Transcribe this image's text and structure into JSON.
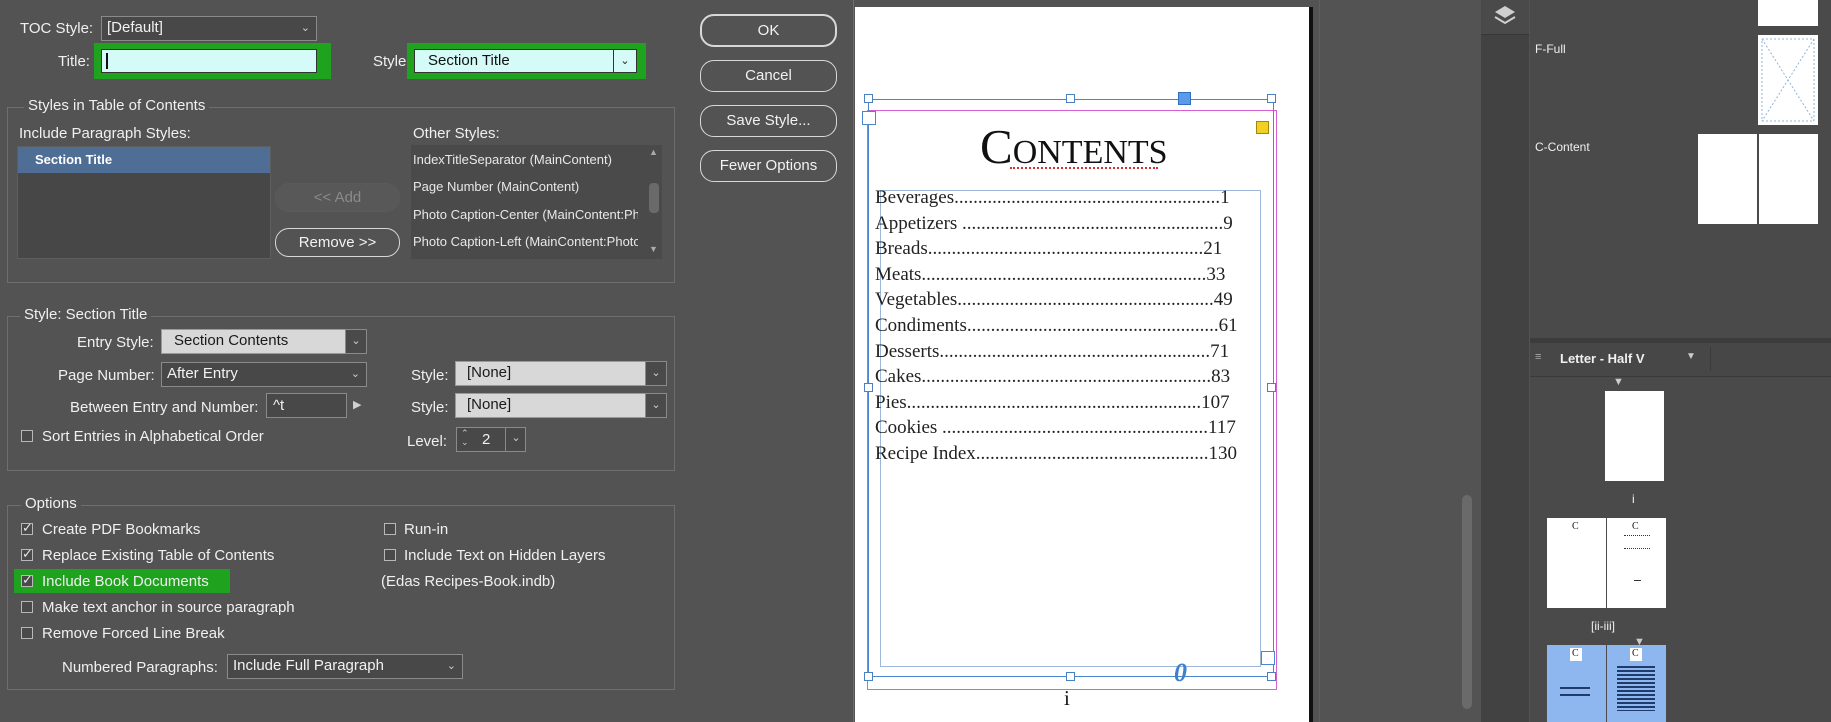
{
  "dialog": {
    "toc_style_label": "TOC Style:",
    "toc_style_value": "[Default]",
    "title_label": "Title:",
    "title_value": "",
    "style_label": "Style:",
    "style_value": "Section Title",
    "buttons": {
      "ok": "OK",
      "cancel": "Cancel",
      "save_style": "Save Style...",
      "fewer_options": "Fewer Options"
    },
    "styles_group": {
      "title": "Styles in Table of Contents",
      "include_label": "Include Paragraph Styles:",
      "include_items": [
        "Section Title"
      ],
      "add_button": "<< Add",
      "remove_button": "Remove >>",
      "other_label": "Other Styles:",
      "other_items": [
        "IndexTitleSeparator (MainContent)",
        "Page Number (MainContent)",
        "Photo Caption-Center (MainContent:Ph...",
        "Photo Caption-Left (MainContent:Photo..."
      ]
    },
    "style_group": {
      "title": "Style: Section Title",
      "entry_style_label": "Entry Style:",
      "entry_style_value": "Section Contents",
      "page_number_label": "Page Number:",
      "page_number_value": "After Entry",
      "page_number_style_label": "Style:",
      "page_number_style_value": "[None]",
      "between_label": "Between Entry and Number:",
      "between_value": "^t",
      "between_style_label": "Style:",
      "between_style_value": "[None]",
      "sort_label": "Sort Entries in Alphabetical Order",
      "level_label": "Level:",
      "level_value": "2"
    },
    "options_group": {
      "title": "Options",
      "create_pdf": "Create PDF Bookmarks",
      "replace_existing": "Replace Existing Table of Contents",
      "include_book": "Include Book Documents",
      "make_anchor": "Make text anchor in source paragraph",
      "remove_break": "Remove Forced Line Break",
      "run_in": "Run-in",
      "hidden_layers": "Include Text on Hidden Layers",
      "book_file": "(Edas Recipes-Book.indb)",
      "numbered_label": "Numbered Paragraphs:",
      "numbered_value": "Include Full Paragraph"
    },
    "checkbox_states": {
      "create_pdf": true,
      "replace_existing": true,
      "include_book": true,
      "make_anchor": false,
      "remove_break": false,
      "run_in": false,
      "hidden_layers": false,
      "sort": false
    }
  },
  "document": {
    "heading_first": "C",
    "heading_rest": "ONTENTS",
    "entries": [
      "Beverages........................................................1",
      "Appetizers .......................................................9",
      "Breads..........................................................21",
      "Meats............................................................33",
      "Vegetables......................................................49",
      "Condiments.....................................................61",
      "Desserts.........................................................71",
      "Cakes.............................................................83",
      "Pies..............................................................107",
      "Cookies ........................................................117",
      "Recipe Index.................................................130"
    ],
    "overset_marker": "0",
    "page_folio": "i"
  },
  "pages_panel": {
    "master_f": "F-Full",
    "master_c": "C-Content",
    "master_dropdown": "Letter - Half V",
    "page_i": "i",
    "page_ii_iii": "[ii-iii]",
    "thumb_c": "C"
  },
  "colors": {
    "highlight_green": "#1fa31f",
    "selection_blue": "#4f6e95",
    "field_cyan": "#d4fbf7",
    "frame_blue": "#4a86d0"
  }
}
